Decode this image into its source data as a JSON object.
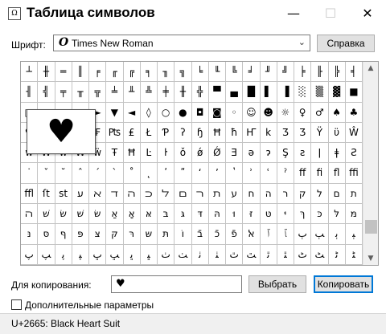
{
  "window": {
    "title": "Таблица символов",
    "app_icon_glyph": "Ω",
    "minimize_glyph": "—",
    "maximize_glyph": "☐",
    "close_glyph": "✕"
  },
  "font": {
    "label": "Шрифт:",
    "icon_glyph": "O",
    "selected": "Times New Roman",
    "chevron": "⌄"
  },
  "help_button": "Справка",
  "grid": {
    "rows": [
      [
        "┴",
        "╫",
        "═",
        "║",
        "╒",
        "╓",
        "╔",
        "╕",
        "╖",
        "╗",
        "╘",
        "╙",
        "╚",
        "╛",
        "╜",
        "╝",
        "╞",
        "╟",
        "╠",
        "╡"
      ],
      [
        "╢",
        "╣",
        "╤",
        "╥",
        "╦",
        "╧",
        "╨",
        "╩",
        "╪",
        "╫",
        "╬",
        "▀",
        "▄",
        "█",
        "▌",
        "▐",
        "░",
        "▒",
        "▓",
        "■"
      ],
      [
        "□",
        "▪",
        "▫",
        "▲",
        "►",
        "▼",
        "◄",
        "◊",
        "○",
        "●",
        "◘",
        "◙",
        "◦",
        "☺",
        "☻",
        "☼",
        "♀",
        "♂",
        "♠",
        "♣"
      ],
      [
        "♥",
        "♦",
        "♪",
        "♫",
        "₣",
        "₧",
        "₤",
        "Ł",
        "Ƥ",
        "ʔ",
        "ɧ",
        "Ħ",
        "ħ",
        "Ҥ",
        "k",
        "Ʒ",
        "Ʒ",
        "Ϋ",
        "ϋ",
        "Ŵ"
      ],
      [
        "ŵ",
        "Ŵ",
        "ẃ",
        "Ẅ",
        "ẅ",
        "Ŧ",
        "Ħ",
        "Ŀ",
        "ŀ",
        "ǒ",
        "ǿ",
        "Ǿ",
        "Ǝ",
        "ǝ",
        "ɂ",
        "Ş",
        "ƨ",
        "ǀ",
        "ǂ",
        "Ƨ"
      ],
      [
        "˙",
        "ˇ",
        "˘",
        "ˆ",
        "ˊ",
        "ˋ",
        "˚",
        "˛",
        "ʹ",
        "ʺ",
        "ʻ",
        "ʼ",
        "ʽ",
        "ʾ",
        "ʿ",
        "ˀ",
        "ff",
        "fi",
        "fl",
        "ffi"
      ],
      [
        "ffl",
        "ſt",
        "st",
        "ﬠ",
        "ﬡ",
        "ﬢ",
        "ﬣ",
        "ﬤ",
        "ﬥ",
        "ﬦ",
        "ﬧ",
        "ﬨ",
        "ע",
        "ח",
        "ה",
        "ר",
        "ק",
        "ל",
        "ם",
        "ת"
      ],
      [
        "ﬣ",
        "שׁ",
        "שׂ",
        "שּׁ",
        "שּׂ",
        "אַ",
        "אָ",
        "אּ",
        "בּ",
        "גּ",
        "דּ",
        "הּ",
        "וּ",
        "זּ",
        "טּ",
        "יּ",
        "ךּ",
        "כּ",
        "לּ",
        "מּ"
      ],
      [
        "נּ",
        "סּ",
        "ףּ",
        "פּ",
        "צּ",
        "קּ",
        "רּ",
        "שּ",
        "תּ",
        "וֹ",
        "בֿ",
        "כֿ",
        "פֿ",
        "ﭏ",
        "ﭐ",
        "ﭑ",
        "ﭒ",
        "ﭓ",
        "ﭔ",
        "ﭕ"
      ],
      [
        "ﭖ",
        "ﭗ",
        "ﭘ",
        "ﭙ",
        "ﭚ",
        "ﭛ",
        "ﭜ",
        "ﭝ",
        "ﭞ",
        "ﭟ",
        "ﭠ",
        "ﭡ",
        "ﭢ",
        "ﭣ",
        "ﭤ",
        "ﭥ",
        "ﭦ",
        "ﭧ",
        "ﭨ",
        "ﭩ"
      ]
    ],
    "selected_char": "♥",
    "scroll_up_glyph": "▲",
    "scroll_down_glyph": "▼"
  },
  "copy": {
    "label": "Для копирования:",
    "value": "♥",
    "select_button": "Выбрать",
    "copy_button": "Копировать"
  },
  "advanced": {
    "checkbox_label": "Дополнительные параметры",
    "checked": false
  },
  "status": {
    "text": "U+2665: Black Heart Suit"
  }
}
